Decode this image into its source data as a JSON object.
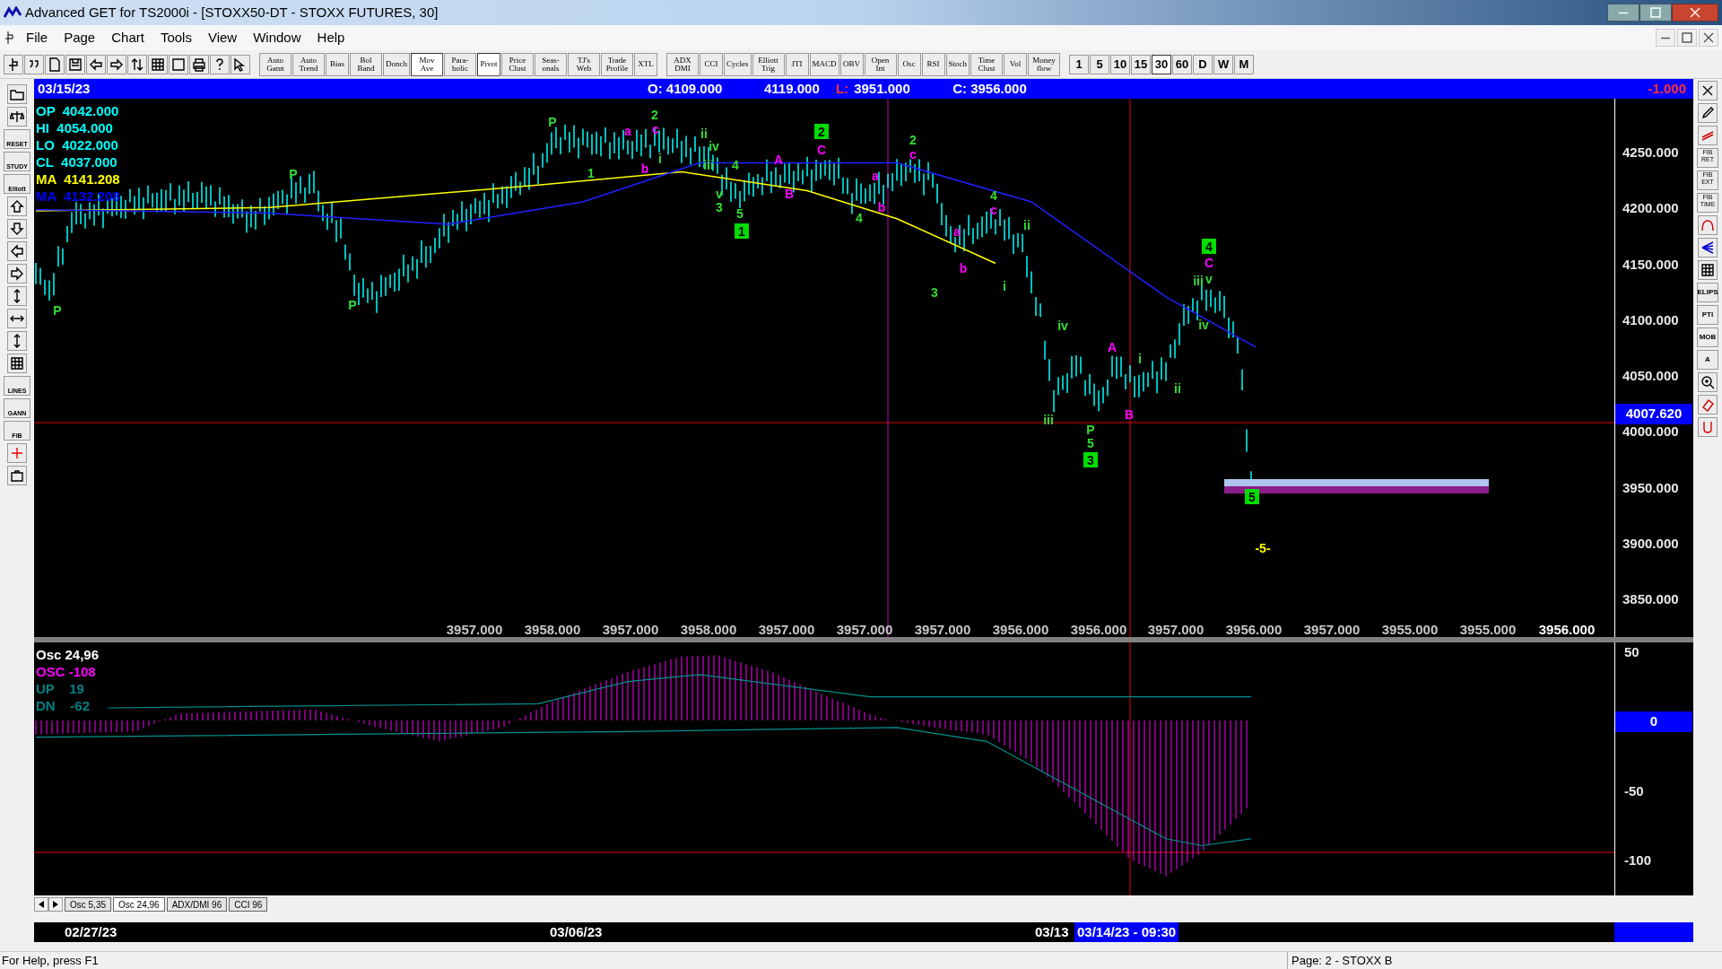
{
  "window": {
    "title": "Advanced GET for TS2000i - [STOXX50-DT - STOXX FUTURES, 30]"
  },
  "menu": [
    "File",
    "Page",
    "Chart",
    "Tools",
    "View",
    "Window",
    "Help"
  ],
  "toolbar": [
    {
      "label": "Auto Gann",
      "pressed": false
    },
    {
      "label": "Auto Trend",
      "pressed": false
    },
    {
      "label": "Bias",
      "pressed": false
    },
    {
      "label": "Bol Band",
      "pressed": false
    },
    {
      "label": "Donch",
      "pressed": false
    },
    {
      "label": "Mov Ave",
      "pressed": true
    },
    {
      "label": "Para-bolic",
      "pressed": false
    },
    {
      "label": "Pivot",
      "pressed": true
    },
    {
      "label": "Price Clust",
      "pressed": false
    },
    {
      "label": "Seas-onals",
      "pressed": false
    },
    {
      "label": "TJ's Web",
      "pressed": false
    },
    {
      "label": "Trade Profile",
      "pressed": false
    },
    {
      "label": "XTL",
      "pressed": false
    }
  ],
  "toolbar_2": [
    {
      "label": "ADX DMI",
      "pressed": false
    },
    {
      "label": "CCI",
      "pressed": false
    },
    {
      "label": "Cycles",
      "pressed": false
    },
    {
      "label": "Elliott Trig",
      "pressed": false
    },
    {
      "label": "JTI",
      "pressed": false
    },
    {
      "label": "MACD",
      "pressed": false
    },
    {
      "label": "OBV",
      "pressed": false
    },
    {
      "label": "Open Int",
      "pressed": false
    },
    {
      "label": "Osc",
      "pressed": false
    },
    {
      "label": "RSI",
      "pressed": false
    },
    {
      "label": "Stoch",
      "pressed": false
    },
    {
      "label": "Time Clust",
      "pressed": false
    },
    {
      "label": "Vol",
      "pressed": false
    },
    {
      "label": "Money flow",
      "pressed": false
    }
  ],
  "intervals": [
    {
      "label": "1",
      "selected": false
    },
    {
      "label": "5",
      "selected": false
    },
    {
      "label": "10",
      "selected": false
    },
    {
      "label": "15",
      "selected": false
    },
    {
      "label": "30",
      "selected": true
    },
    {
      "label": "60",
      "selected": false
    },
    {
      "label": "D",
      "selected": false
    },
    {
      "label": "W",
      "selected": false
    },
    {
      "label": "M",
      "selected": false
    }
  ],
  "left_toolbar": [
    "RESET",
    "STUDY",
    "Elliott",
    "LINES",
    "GANN",
    "FIB"
  ],
  "right_toolbar": [
    "FIB RET",
    "FIB EXT",
    "FIB TIME",
    "ELIPS",
    "PTI",
    "MOB",
    "A"
  ],
  "header": {
    "date": "03/15/23",
    "open": "O: 4109.000",
    "high": "4119.000",
    "low_label": "L:",
    "low": "3951.000",
    "close": "C: 3956.000",
    "change": "-1.000"
  },
  "legend": [
    {
      "label": "OP",
      "value": "4042.000",
      "color": "#00ffff"
    },
    {
      "label": "HI",
      "value": "4054.000",
      "color": "#00ffff"
    },
    {
      "label": "LO",
      "value": "4022.000",
      "color": "#00ffff"
    },
    {
      "label": "CL",
      "value": "4037.000",
      "color": "#00ffff"
    },
    {
      "label": "MA",
      "value": "4141.208",
      "color": "#ffff00"
    },
    {
      "label": "MA",
      "value": "4132.208",
      "color": "#0000ff"
    }
  ],
  "price_axis": [
    "4250.000",
    "4200.000",
    "4150.000",
    "4100.000",
    "4050.000",
    "4000.000",
    "3950.000",
    "3900.000",
    "3850.000"
  ],
  "current_price": "4007.620",
  "bottom_values": [
    "3957.000",
    "3958.000",
    "3957.000",
    "3958.000",
    "3957.000",
    "3957.000",
    "3957.000",
    "3956.000",
    "3956.000",
    "3957.000",
    "3956.000",
    "3957.000",
    "3955.000",
    "3955.000",
    "3956.000"
  ],
  "wave_labels": [
    {
      "text": "P",
      "kind": "plain",
      "color": "#33dd33"
    },
    {
      "text": "P",
      "kind": "plain",
      "color": "#33dd33"
    },
    {
      "text": "P",
      "kind": "plain",
      "color": "#33dd33"
    },
    {
      "text": "P",
      "kind": "plain",
      "color": "#33dd33"
    },
    {
      "text": "1",
      "kind": "plain",
      "color": "#33dd33"
    },
    {
      "text": "2",
      "kind": "plain",
      "color": "#33dd33"
    },
    {
      "text": "a",
      "kind": "plain",
      "color": "#ff00ff"
    },
    {
      "text": "b",
      "kind": "plain",
      "color": "#ff00ff"
    },
    {
      "text": "c",
      "kind": "plain",
      "color": "#ff00ff"
    },
    {
      "text": "i",
      "kind": "plain",
      "color": "#33dd33"
    },
    {
      "text": "ii",
      "kind": "plain",
      "color": "#33dd33"
    },
    {
      "text": "iv",
      "kind": "plain",
      "color": "#33dd33"
    },
    {
      "text": "iii",
      "kind": "plain",
      "color": "#33dd33"
    },
    {
      "text": "4",
      "kind": "plain",
      "color": "#33dd33"
    },
    {
      "text": "v",
      "kind": "plain",
      "color": "#33dd33"
    },
    {
      "text": "3",
      "kind": "plain",
      "color": "#33dd33"
    },
    {
      "text": "5",
      "kind": "plain",
      "color": "#33dd33"
    },
    {
      "text": "1",
      "kind": "boxed",
      "color": "#00dd00"
    },
    {
      "text": "A",
      "kind": "plain",
      "color": "#ff00ff"
    },
    {
      "text": "B",
      "kind": "plain",
      "color": "#ff00ff"
    },
    {
      "text": "2",
      "kind": "boxed",
      "color": "#00dd00"
    },
    {
      "text": "C",
      "kind": "plain",
      "color": "#ff00ff"
    },
    {
      "text": "a",
      "kind": "plain",
      "color": "#ff00ff"
    },
    {
      "text": "b",
      "kind": "plain",
      "color": "#ff00ff"
    },
    {
      "text": "4",
      "kind": "plain",
      "color": "#33dd33"
    },
    {
      "text": "2",
      "kind": "plain",
      "color": "#33dd33"
    },
    {
      "text": "c",
      "kind": "plain",
      "color": "#ff00ff"
    },
    {
      "text": "4",
      "kind": "plain",
      "color": "#33dd33"
    },
    {
      "text": "c",
      "kind": "plain",
      "color": "#ff00ff"
    },
    {
      "text": "a",
      "kind": "plain",
      "color": "#ff00ff"
    },
    {
      "text": "b",
      "kind": "plain",
      "color": "#ff00ff"
    },
    {
      "text": "3",
      "kind": "plain",
      "color": "#33dd33"
    },
    {
      "text": "ii",
      "kind": "plain",
      "color": "#33dd33"
    },
    {
      "text": "i",
      "kind": "plain",
      "color": "#33dd33"
    },
    {
      "text": "iv",
      "kind": "plain",
      "color": "#33dd33"
    },
    {
      "text": "iii",
      "kind": "plain",
      "color": "#33dd33"
    },
    {
      "text": "P",
      "kind": "plain",
      "color": "#33dd33"
    },
    {
      "text": "5",
      "kind": "plain",
      "color": "#33dd33"
    },
    {
      "text": "3",
      "kind": "boxed",
      "color": "#00dd00"
    },
    {
      "text": "A",
      "kind": "plain",
      "color": "#ff00ff"
    },
    {
      "text": "B",
      "kind": "plain",
      "color": "#ff00ff"
    },
    {
      "text": "i",
      "kind": "plain",
      "color": "#33dd33"
    },
    {
      "text": "ii",
      "kind": "plain",
      "color": "#33dd33"
    },
    {
      "text": "4",
      "kind": "boxed",
      "color": "#00dd00"
    },
    {
      "text": "C",
      "kind": "plain",
      "color": "#ff00ff"
    },
    {
      "text": "iii",
      "kind": "plain",
      "color": "#33dd33"
    },
    {
      "text": "v",
      "kind": "plain",
      "color": "#33dd33"
    },
    {
      "text": "iv",
      "kind": "plain",
      "color": "#33dd33"
    },
    {
      "text": "5",
      "kind": "boxed",
      "color": "#00dd00"
    },
    {
      "text": "-5-",
      "kind": "plain",
      "color": "#ffff00"
    }
  ],
  "osc_legend": [
    {
      "label": "Osc 24,96",
      "color": "#ffffff"
    },
    {
      "label": "OSC -108",
      "color": "#ff00ff"
    },
    {
      "label": "UP    19",
      "color": "#008080"
    },
    {
      "label": "DN    -62",
      "color": "#008080"
    }
  ],
  "osc_axis": [
    "50",
    "-50",
    "-100"
  ],
  "osc_zero": "0",
  "tabs": [
    {
      "label": "Osc 5,35",
      "selected": false
    },
    {
      "label": "Osc 24,96",
      "selected": true
    },
    {
      "label": "ADX/DMI 96",
      "selected": false
    },
    {
      "label": "CCI 96",
      "selected": false
    }
  ],
  "dates": [
    {
      "label": "02/27/23",
      "selected": false
    },
    {
      "label": "03/06/23",
      "selected": false
    },
    {
      "label": "03/13",
      "selected": false
    },
    {
      "label": "03/14/23 - 09:30",
      "selected": true
    }
  ],
  "status_bar": {
    "help": "For Help, press F1",
    "page": "Page: 2 - STOXX B"
  }
}
